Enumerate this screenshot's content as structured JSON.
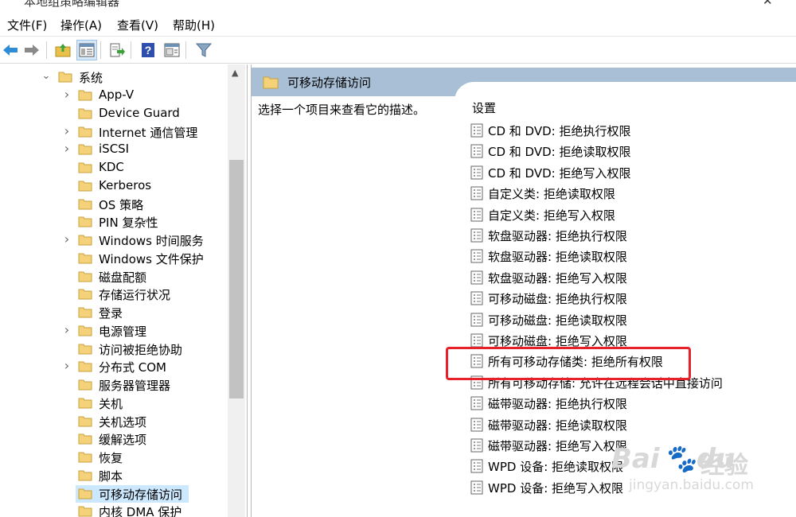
{
  "window": {
    "title": "本地组策略编辑器",
    "close_glyph": "✕"
  },
  "menubar": {
    "items": [
      "文件(F)",
      "操作(A)",
      "查看(V)",
      "帮助(H)"
    ]
  },
  "toolbar": {
    "buttons": [
      "back-arrow-icon",
      "forward-arrow-icon",
      "up-folder-icon",
      "show-hide-tree-icon",
      "export-list-icon",
      "help-icon",
      "properties-icon",
      "filter-icon"
    ]
  },
  "tree": {
    "collapse_glyph": "⌄",
    "expand_glyph": "›",
    "root": "系统",
    "items": [
      {
        "label": "App-V",
        "expandable": true
      },
      {
        "label": "Device Guard",
        "expandable": false
      },
      {
        "label": "Internet 通信管理",
        "expandable": true
      },
      {
        "label": "iSCSI",
        "expandable": true
      },
      {
        "label": "KDC",
        "expandable": false
      },
      {
        "label": "Kerberos",
        "expandable": false
      },
      {
        "label": "OS 策略",
        "expandable": false
      },
      {
        "label": "PIN 复杂性",
        "expandable": false
      },
      {
        "label": "Windows 时间服务",
        "expandable": true
      },
      {
        "label": "Windows 文件保护",
        "expandable": false
      },
      {
        "label": "磁盘配额",
        "expandable": false
      },
      {
        "label": "存储运行状况",
        "expandable": false
      },
      {
        "label": "登录",
        "expandable": false
      },
      {
        "label": "电源管理",
        "expandable": true
      },
      {
        "label": "访问被拒绝协助",
        "expandable": false
      },
      {
        "label": "分布式 COM",
        "expandable": true
      },
      {
        "label": "服务器管理器",
        "expandable": false
      },
      {
        "label": "关机",
        "expandable": false
      },
      {
        "label": "关机选项",
        "expandable": false
      },
      {
        "label": "缓解选项",
        "expandable": false
      },
      {
        "label": "恢复",
        "expandable": false
      },
      {
        "label": "脚本",
        "expandable": false
      },
      {
        "label": "可移动存储访问",
        "expandable": false,
        "selected": true
      },
      {
        "label": "内核 DMA 保护",
        "expandable": false
      }
    ],
    "scroll_up_glyph": "▲"
  },
  "details": {
    "header_title": "可移动存储访问",
    "description": "选择一个项目来查看它的描述。",
    "settings_header": "设置",
    "settings": [
      "CD 和 DVD: 拒绝执行权限",
      "CD 和 DVD: 拒绝读取权限",
      "CD 和 DVD: 拒绝写入权限",
      "自定义类: 拒绝读取权限",
      "自定义类: 拒绝写入权限",
      "软盘驱动器: 拒绝执行权限",
      "软盘驱动器: 拒绝读取权限",
      "软盘驱动器: 拒绝写入权限",
      "可移动磁盘: 拒绝执行权限",
      "可移动磁盘: 拒绝读取权限",
      "可移动磁盘: 拒绝写入权限",
      "所有可移动存储类: 拒绝所有权限",
      "所有可移动存储: 允许在远程会话中直接访问",
      "磁带驱动器: 拒绝执行权限",
      "磁带驱动器: 拒绝读取权限",
      "磁带驱动器: 拒绝写入权限",
      "WPD 设备: 拒绝读取权限",
      "WPD 设备: 拒绝写入权限"
    ],
    "highlighted_setting_index": 11
  },
  "watermark": {
    "brand": "Bai",
    "brand2": "du",
    "cn": "经验",
    "url": "jingyan.baidu.com"
  },
  "colors": {
    "header_band": "#a8bfd6",
    "selection": "#cce8ff",
    "highlight": "#e8202a",
    "folder": "#f5d27a"
  }
}
